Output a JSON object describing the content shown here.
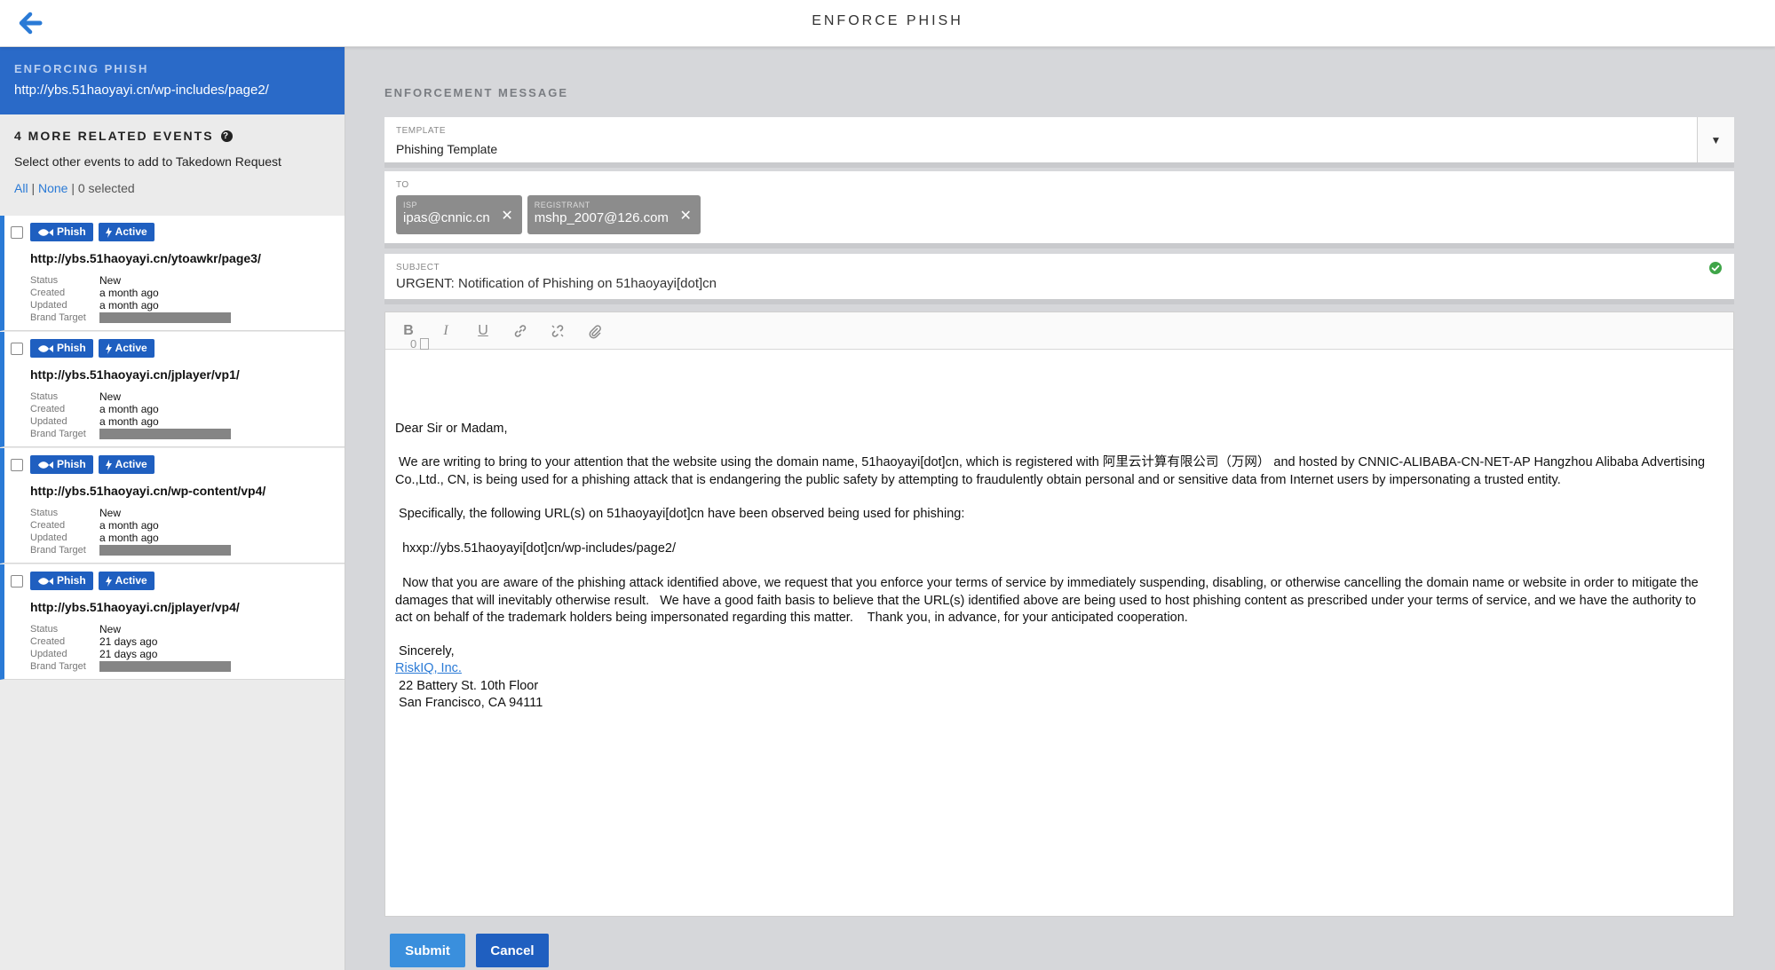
{
  "header": {
    "title": "ENFORCE PHISH"
  },
  "sidebar": {
    "enforcing_label": "ENFORCING PHISH",
    "enforcing_url": "http://ybs.51haoyayi.cn/wp-includes/page2/",
    "related_title": "4 MORE RELATED EVENTS",
    "related_desc": "Select other events to add to Takedown Request",
    "select_all": "All",
    "select_none": "None",
    "selected_count": "0 selected",
    "events": [
      {
        "badge_type": "Phish",
        "badge_status": "Active",
        "url": "http://ybs.51haoyayi.cn/ytoawkr/page3/",
        "status_key": "Status",
        "status": "New",
        "created_key": "Created",
        "created": "a month ago",
        "updated_key": "Updated",
        "updated": "a month ago",
        "brand_key": "Brand Target"
      },
      {
        "badge_type": "Phish",
        "badge_status": "Active",
        "url": "http://ybs.51haoyayi.cn/jplayer/vp1/",
        "status_key": "Status",
        "status": "New",
        "created_key": "Created",
        "created": "a month ago",
        "updated_key": "Updated",
        "updated": "a month ago",
        "brand_key": "Brand Target"
      },
      {
        "badge_type": "Phish",
        "badge_status": "Active",
        "url": "http://ybs.51haoyayi.cn/wp-content/vp4/",
        "status_key": "Status",
        "status": "New",
        "created_key": "Created",
        "created": "a month ago",
        "updated_key": "Updated",
        "updated": "a month ago",
        "brand_key": "Brand Target"
      },
      {
        "badge_type": "Phish",
        "badge_status": "Active",
        "url": "http://ybs.51haoyayi.cn/jplayer/vp4/",
        "status_key": "Status",
        "status": "New",
        "created_key": "Created",
        "created": "21 days ago",
        "updated_key": "Updated",
        "updated": "21 days ago",
        "brand_key": "Brand Target"
      }
    ]
  },
  "main": {
    "section_label": "ENFORCEMENT MESSAGE",
    "template_label": "TEMPLATE",
    "template_value": "Phishing Template",
    "to_label": "TO",
    "recipients": [
      {
        "label": "ISP",
        "value": "ipas@cnnic.cn"
      },
      {
        "label": "REGISTRANT",
        "value": "mshp_2007@126.com"
      }
    ],
    "subject_label": "SUBJECT",
    "subject_value": "URGENT: Notification of Phishing on 51haoyayi[dot]cn",
    "attachment_count": "0",
    "body": {
      "greeting": "Dear Sir or Madam,",
      "p1": " We are writing to bring to your attention that the website using the domain name, 51haoyayi[dot]cn, which is registered with 阿里云计算有限公司（万网） and hosted by CNNIC-ALIBABA-CN-NET-AP Hangzhou Alibaba Advertising Co.,Ltd., CN, is being used for a phishing attack that is endangering the public safety by attempting to fraudulently obtain personal and or sensitive data from Internet users by impersonating a trusted entity.",
      "p2": " Specifically, the following URL(s) on 51haoyayi[dot]cn have been observed being used for phishing:",
      "p3": "  hxxp://ybs.51haoyayi[dot]cn/wp-includes/page2/",
      "p4": "  Now that you are aware of the phishing attack identified above, we request that you enforce your terms of service by immediately suspending, disabling, or otherwise cancelling the domain name or website in order to mitigate the damages that will inevitably otherwise result.   We have a good faith basis to believe that the URL(s) identified above are being used to host phishing content as prescribed under your terms of service, and we have the authority to act on behalf of the trademark holders being impersonated regarding this matter.    Thank you, in advance, for your anticipated cooperation.",
      "sincerely": " Sincerely,",
      "company": "RiskIQ, Inc.",
      "address1": " 22 Battery St. 10th Floor",
      "address2": " San Francisco, CA 94111"
    },
    "submit_label": "Submit",
    "cancel_label": "Cancel"
  },
  "colors": {
    "accent": "#2a6ac8",
    "badge": "#1f5fc0",
    "submit": "#3a8fdd",
    "link": "#2a7ad6"
  },
  "icons": [
    "back-arrow-icon",
    "help-icon",
    "fish-icon",
    "bolt-icon",
    "close-icon",
    "check-circle-icon",
    "bold-icon",
    "italic-icon",
    "underline-icon",
    "link-icon",
    "unlink-icon",
    "attach-icon",
    "document-icon",
    "chevron-down-icon"
  ]
}
